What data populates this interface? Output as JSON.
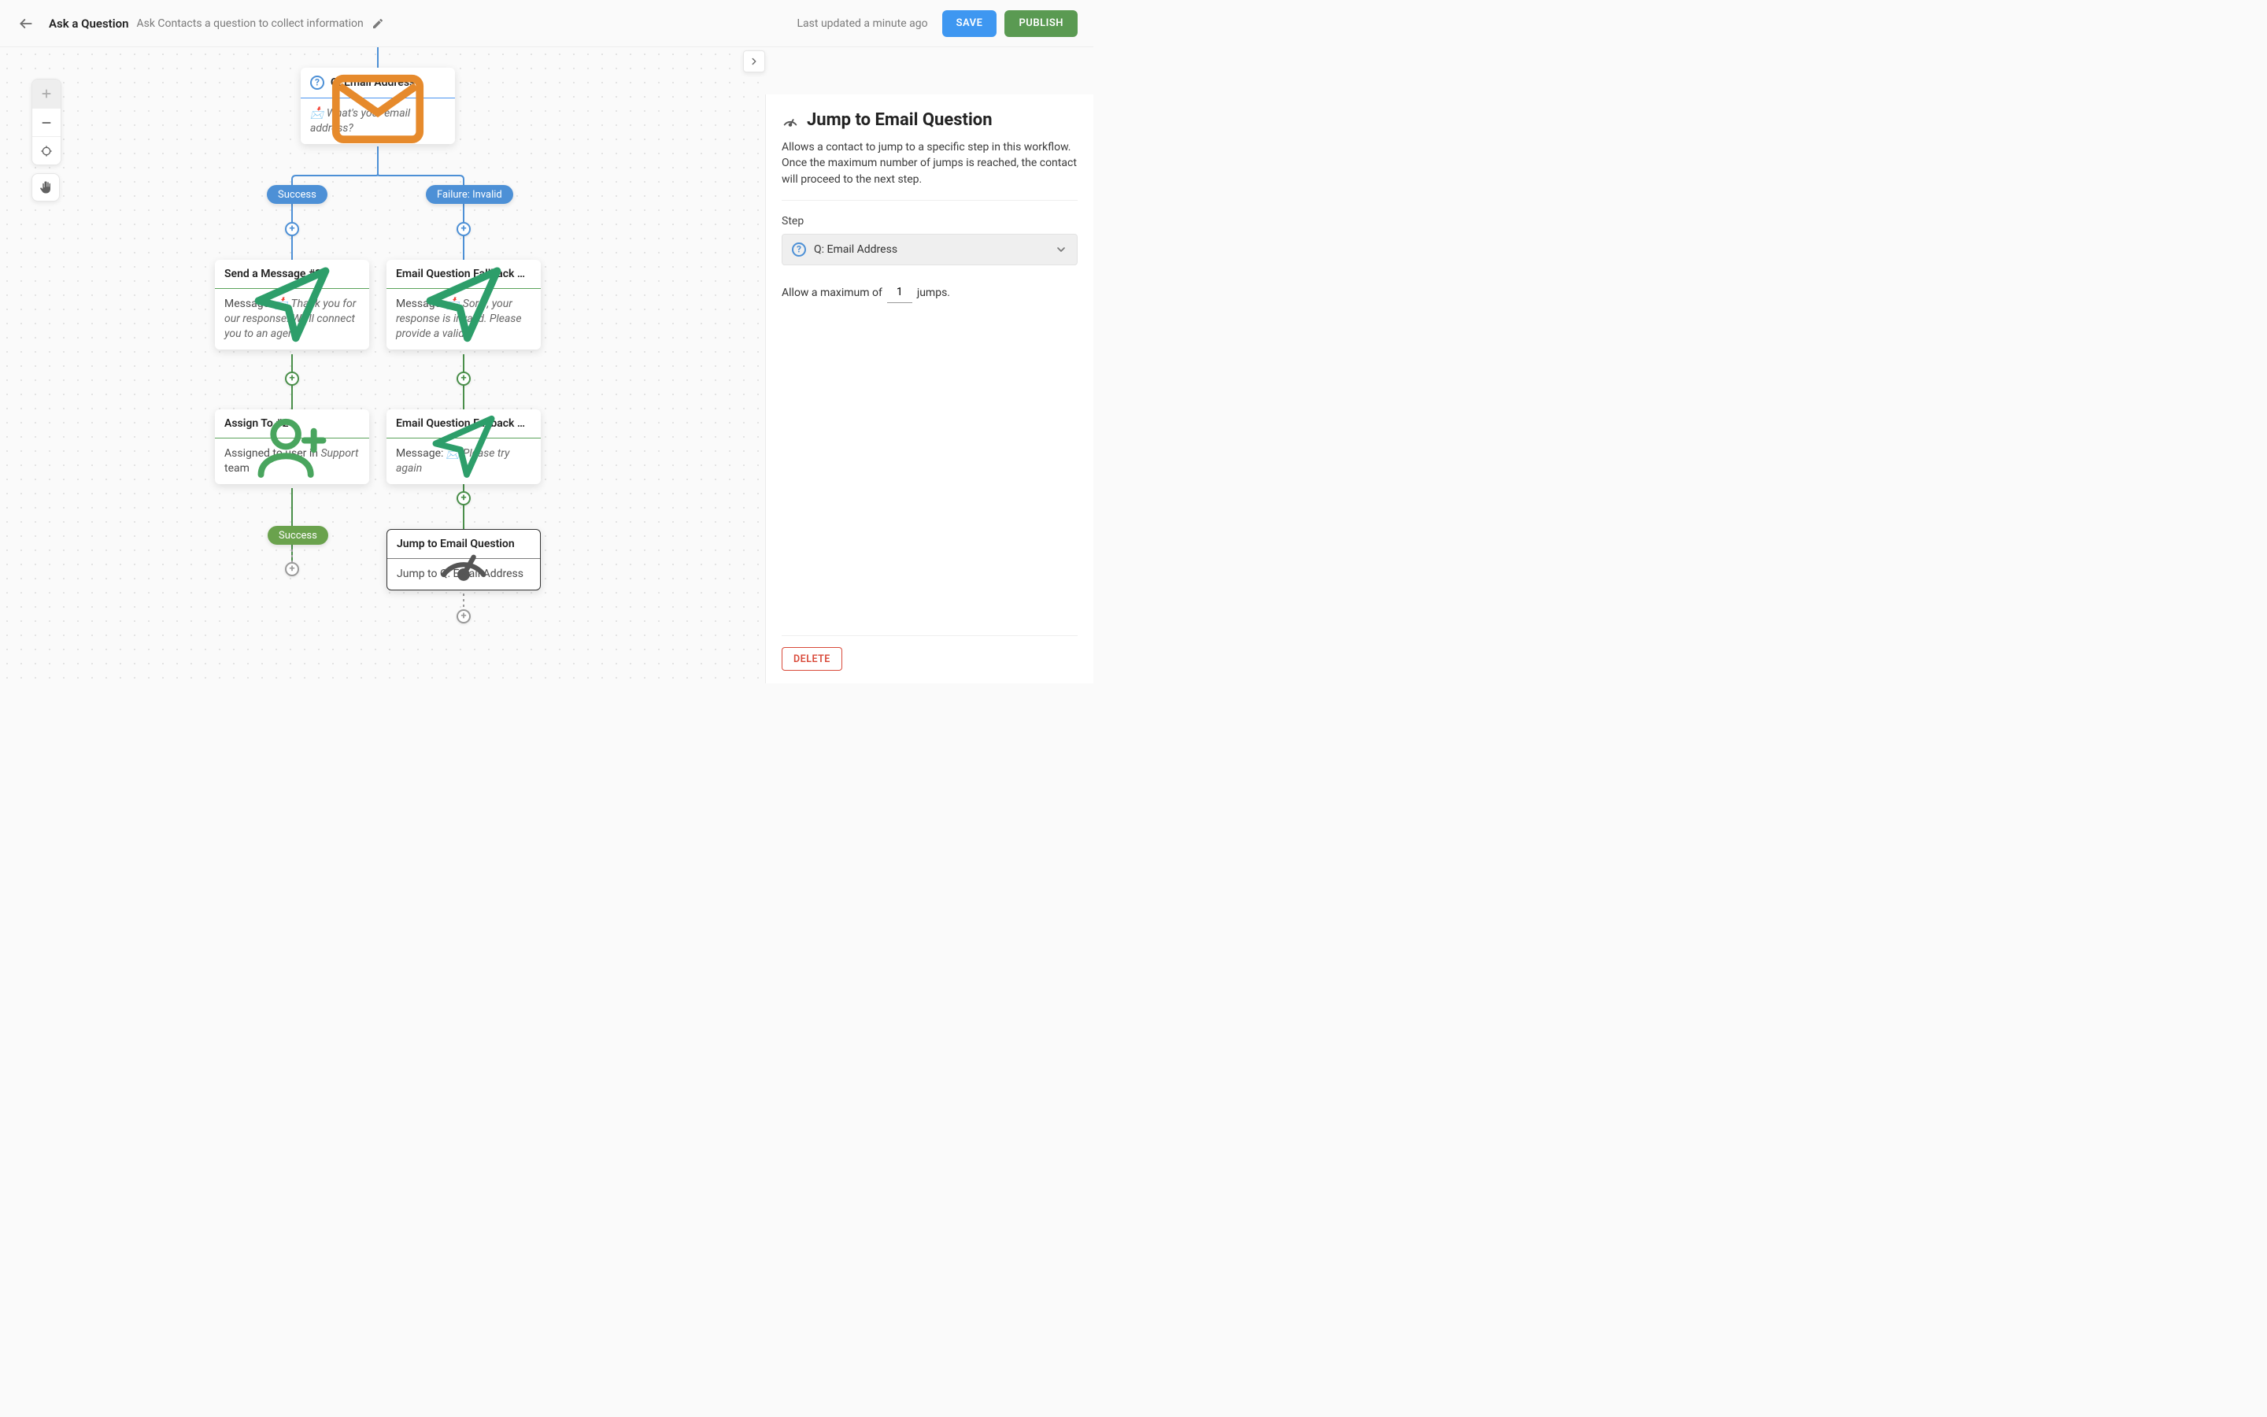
{
  "header": {
    "title": "Ask a Question",
    "subtitle": "Ask Contacts a question to collect information",
    "updated": "Last updated a minute ago",
    "save": "SAVE",
    "publish": "PUBLISH"
  },
  "labels": {
    "success": "Success",
    "failure": "Failure: Invalid"
  },
  "nodes": {
    "email_q": {
      "title": "Q: Email Address",
      "prompt_prefix": "📩 ",
      "prompt": "What's your email address?"
    },
    "send3": {
      "title": "Send a Message #3",
      "label": "Message: ",
      "emoji": "📩 ",
      "text": "Thank you for our response. We'll connect you to an agent."
    },
    "assign2": {
      "title": "Assign To #2",
      "prefix": "Assigned to user in ",
      "team": "Support",
      "suffix": " team"
    },
    "fb1": {
      "title": "Email Question Fallback …",
      "label": "Message: ",
      "emoji": "📩 ",
      "text": "Sorry, your response is invalid. Please provide a valid..."
    },
    "fb2": {
      "title": "Email Question Fallback …",
      "label": "Message: ",
      "emoji": "📩 ",
      "text": "Please try again"
    },
    "jump": {
      "title": "Jump to Email Question",
      "body": "Jump to Q: Email Address"
    }
  },
  "panel": {
    "title": "Jump to Email Question",
    "description": "Allows a contact to jump to a specific step in this workflow. Once the maximum number of jumps is reached, the contact will proceed to the next step.",
    "step_label": "Step",
    "step_value": "Q: Email Address",
    "max_prefix": "Allow a maximum of",
    "max_value": "1",
    "max_suffix": "jumps.",
    "delete": "DELETE"
  }
}
